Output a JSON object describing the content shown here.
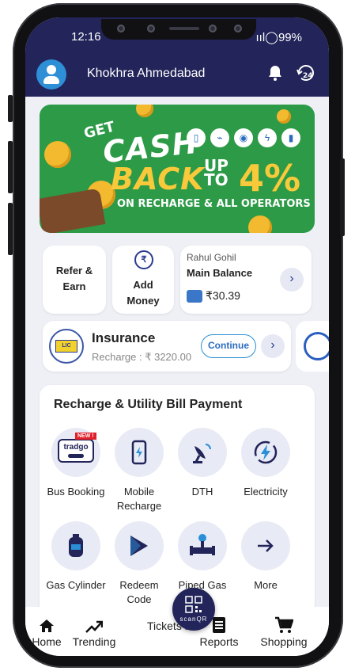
{
  "status": {
    "time": "12:16",
    "battery": "99%"
  },
  "header": {
    "location": "Khokhra Ahmedabad"
  },
  "banner": {
    "get": "GET",
    "cash": "CASH",
    "back": "BACK",
    "up": "UP",
    "to": "TO",
    "percent": "4%",
    "tagline": "ON RECHARGE & ALL OPERATORS",
    "colors": {
      "bg": "#2c9a46",
      "gold": "#f8c93a"
    }
  },
  "cards": {
    "refer": "Refer &\nEarn",
    "add_money": "Add\nMoney",
    "balance": {
      "name": "Rahul Gohil",
      "label": "Main Balance",
      "amount": "₹30.39"
    }
  },
  "insurance": {
    "logo": "LIC",
    "title": "Insurance",
    "sub": "Recharge : ₹ 3220.00",
    "button": "Continue"
  },
  "recharge": {
    "title": "Recharge & Utility Bill Payment",
    "items": [
      {
        "label": "Bus Booking",
        "icon": "bus-icon",
        "badge": "NEW !",
        "logo": "tradgo"
      },
      {
        "label": "Mobile Recharge",
        "icon": "mobile-icon"
      },
      {
        "label": "DTH",
        "icon": "satellite-dish-icon"
      },
      {
        "label": "Electricity",
        "icon": "lightning-icon"
      },
      {
        "label": "Gas Cylinder",
        "icon": "gas-cylinder-icon"
      },
      {
        "label": "Redeem Code",
        "icon": "play-store-icon"
      },
      {
        "label": "Piped Gas",
        "icon": "pipe-icon"
      },
      {
        "label": "More",
        "icon": "arrow-right-icon"
      }
    ]
  },
  "nav": {
    "home": "Home",
    "trending": "Trending",
    "tickets": "Tickets i",
    "reports": "Reports",
    "shopping": "Shopping",
    "scan": "scanQR"
  },
  "colors": {
    "primary": "#22245a",
    "accent": "#2a8fd6",
    "bg": "#eef0f6"
  }
}
